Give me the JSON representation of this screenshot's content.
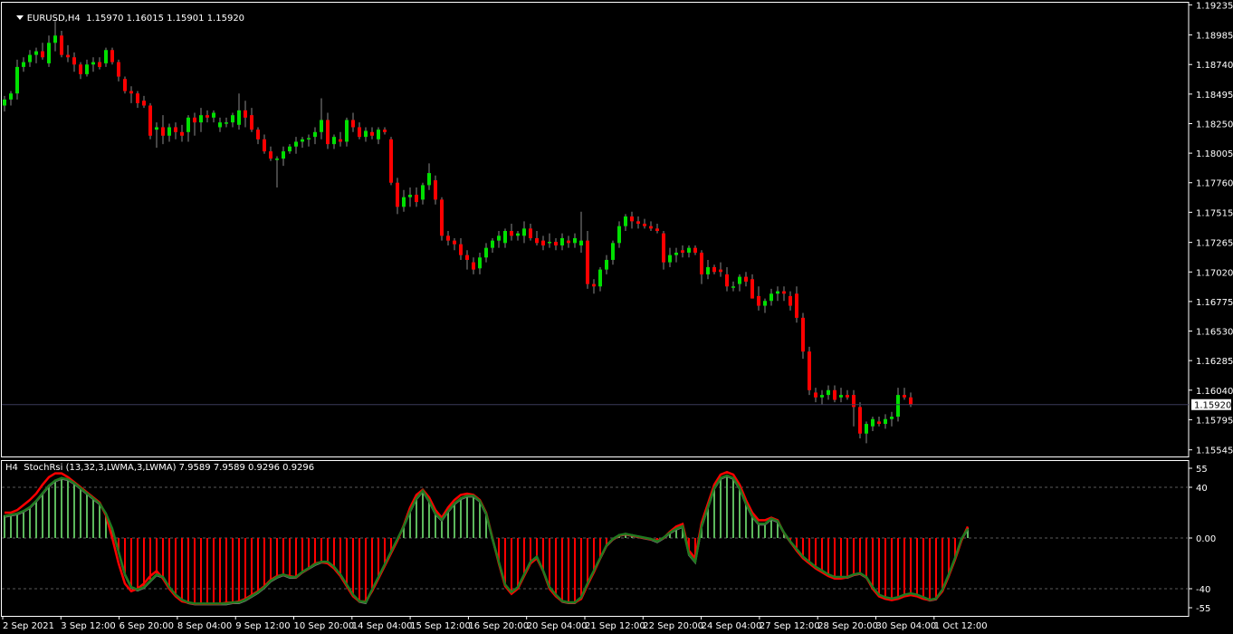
{
  "main_chart": {
    "symbol_period": "EURUSD,H4",
    "ohlc_text": "1.15970 1.16015 1.15901 1.15920",
    "current_price_label": "1.15920",
    "price_min": 1.1549,
    "price_max": 1.1926,
    "bull_color": "#00e000",
    "bear_color": "#ff0000",
    "price_ticks": [
      "1.19235",
      "1.18985",
      "1.18740",
      "1.18495",
      "1.18250",
      "1.18005",
      "1.17760",
      "1.17515",
      "1.17265",
      "1.17020",
      "1.16775",
      "1.16530",
      "1.16285",
      "1.16040",
      "1.15795",
      "1.15545"
    ],
    "candles": [
      [
        1.184,
        1.1848,
        1.1835,
        1.1845
      ],
      [
        1.1845,
        1.1852,
        1.184,
        1.185
      ],
      [
        1.185,
        1.1878,
        1.1845,
        1.1872
      ],
      [
        1.1872,
        1.188,
        1.1868,
        1.1876
      ],
      [
        1.1876,
        1.1886,
        1.1872,
        1.1882
      ],
      [
        1.1882,
        1.1888,
        1.1875,
        1.1885
      ],
      [
        1.1885,
        1.1892,
        1.1878,
        1.188
      ],
      [
        1.1875,
        1.1898,
        1.1872,
        1.1892
      ],
      [
        1.1892,
        1.191,
        1.1885,
        1.1898
      ],
      [
        1.1898,
        1.1902,
        1.188,
        1.1882
      ],
      [
        1.1882,
        1.189,
        1.1876,
        1.188
      ],
      [
        1.188,
        1.1884,
        1.1868,
        1.1874
      ],
      [
        1.1874,
        1.1876,
        1.1862,
        1.1866
      ],
      [
        1.1866,
        1.1878,
        1.1864,
        1.1874
      ],
      [
        1.1874,
        1.188,
        1.1868,
        1.1876
      ],
      [
        1.1876,
        1.188,
        1.187,
        1.1872
      ],
      [
        1.1875,
        1.1888,
        1.1872,
        1.1886
      ],
      [
        1.1886,
        1.1888,
        1.1874,
        1.1876
      ],
      [
        1.1876,
        1.1878,
        1.186,
        1.1864
      ],
      [
        1.1862,
        1.1864,
        1.185,
        1.1852
      ],
      [
        1.1852,
        1.1856,
        1.1842,
        1.185
      ],
      [
        1.185,
        1.1852,
        1.1838,
        1.1842
      ],
      [
        1.1844,
        1.1848,
        1.1838,
        1.184
      ],
      [
        1.184,
        1.1842,
        1.1812,
        1.1815
      ],
      [
        1.182,
        1.1826,
        1.1805,
        1.1822
      ],
      [
        1.1822,
        1.1832,
        1.1808,
        1.1815
      ],
      [
        1.1815,
        1.1825,
        1.181,
        1.1822
      ],
      [
        1.1822,
        1.1826,
        1.1812,
        1.1818
      ],
      [
        1.1818,
        1.1824,
        1.181,
        1.1815
      ],
      [
        1.1818,
        1.1832,
        1.181,
        1.183
      ],
      [
        1.183,
        1.1834,
        1.1815,
        1.1826
      ],
      [
        1.1826,
        1.1838,
        1.1818,
        1.1832
      ],
      [
        1.1832,
        1.1836,
        1.1826,
        1.183
      ],
      [
        1.183,
        1.1836,
        1.1826,
        1.1834
      ],
      [
        1.1822,
        1.183,
        1.1818,
        1.1826
      ],
      [
        1.1826,
        1.183,
        1.1822,
        1.1826
      ],
      [
        1.1826,
        1.1834,
        1.1822,
        1.1832
      ],
      [
        1.1824,
        1.185,
        1.182,
        1.1836
      ],
      [
        1.1836,
        1.1844,
        1.1822,
        1.183
      ],
      [
        1.1832,
        1.1838,
        1.1818,
        1.182
      ],
      [
        1.182,
        1.1822,
        1.1808,
        1.1812
      ],
      [
        1.1812,
        1.1816,
        1.18,
        1.1802
      ],
      [
        1.1802,
        1.1806,
        1.1794,
        1.1796
      ],
      [
        1.1796,
        1.1798,
        1.1772,
        1.1796
      ],
      [
        1.1796,
        1.1806,
        1.179,
        1.1802
      ],
      [
        1.1802,
        1.1808,
        1.18,
        1.1806
      ],
      [
        1.1806,
        1.1814,
        1.18,
        1.181
      ],
      [
        1.181,
        1.1814,
        1.1805,
        1.1812
      ],
      [
        1.1812,
        1.1816,
        1.1806,
        1.1813
      ],
      [
        1.1814,
        1.1822,
        1.1808,
        1.1818
      ],
      [
        1.1818,
        1.1846,
        1.1812,
        1.1828
      ],
      [
        1.1828,
        1.1834,
        1.1804,
        1.1808
      ],
      [
        1.1808,
        1.1816,
        1.1804,
        1.1814
      ],
      [
        1.1812,
        1.1818,
        1.1806,
        1.181
      ],
      [
        1.181,
        1.183,
        1.1806,
        1.1828
      ],
      [
        1.1828,
        1.1834,
        1.1818,
        1.1822
      ],
      [
        1.1822,
        1.1826,
        1.1812,
        1.1814
      ],
      [
        1.1814,
        1.1822,
        1.181,
        1.1819
      ],
      [
        1.1818,
        1.1822,
        1.1812,
        1.1815
      ],
      [
        1.1812,
        1.1822,
        1.1808,
        1.182
      ],
      [
        1.182,
        1.1822,
        1.1816,
        1.1818
      ],
      [
        1.1812,
        1.1814,
        1.1774,
        1.1776
      ],
      [
        1.1776,
        1.178,
        1.175,
        1.1756
      ],
      [
        1.1756,
        1.177,
        1.1752,
        1.1764
      ],
      [
        1.1764,
        1.1772,
        1.1756,
        1.1766
      ],
      [
        1.1766,
        1.1772,
        1.1756,
        1.176
      ],
      [
        1.1762,
        1.1776,
        1.1758,
        1.1774
      ],
      [
        1.1774,
        1.1792,
        1.177,
        1.1784
      ],
      [
        1.1778,
        1.1782,
        1.1758,
        1.1762
      ],
      [
        1.1762,
        1.1764,
        1.1728,
        1.1732
      ],
      [
        1.1732,
        1.1736,
        1.1724,
        1.1728
      ],
      [
        1.1728,
        1.173,
        1.172,
        1.1725
      ],
      [
        1.1725,
        1.173,
        1.1712,
        1.1716
      ],
      [
        1.1716,
        1.172,
        1.1704,
        1.1712
      ],
      [
        1.171,
        1.1714,
        1.17,
        1.1704
      ],
      [
        1.1705,
        1.1718,
        1.17,
        1.1714
      ],
      [
        1.1714,
        1.1726,
        1.171,
        1.1722
      ],
      [
        1.1722,
        1.173,
        1.1718,
        1.1728
      ],
      [
        1.1728,
        1.1736,
        1.1722,
        1.1732
      ],
      [
        1.1726,
        1.1738,
        1.1722,
        1.1736
      ],
      [
        1.1736,
        1.1742,
        1.1728,
        1.1732
      ],
      [
        1.1732,
        1.1736,
        1.1728,
        1.1734
      ],
      [
        1.1732,
        1.1744,
        1.1726,
        1.1738
      ],
      [
        1.1738,
        1.1742,
        1.1728,
        1.173
      ],
      [
        1.173,
        1.1736,
        1.1724,
        1.1726
      ],
      [
        1.1728,
        1.1732,
        1.172,
        1.1724
      ],
      [
        1.1726,
        1.1734,
        1.1722,
        1.1727
      ],
      [
        1.1727,
        1.173,
        1.172,
        1.1724
      ],
      [
        1.1724,
        1.1734,
        1.172,
        1.173
      ],
      [
        1.1728,
        1.1732,
        1.1722,
        1.1726
      ],
      [
        1.1726,
        1.1734,
        1.1722,
        1.173
      ],
      [
        1.1724,
        1.1752,
        1.1718,
        1.1728
      ],
      [
        1.1728,
        1.1736,
        1.1688,
        1.1692
      ],
      [
        1.1692,
        1.1696,
        1.1684,
        1.169
      ],
      [
        1.169,
        1.1706,
        1.1686,
        1.1704
      ],
      [
        1.1704,
        1.1716,
        1.17,
        1.1712
      ],
      [
        1.1712,
        1.1728,
        1.1708,
        1.1726
      ],
      [
        1.1726,
        1.1744,
        1.1722,
        1.174
      ],
      [
        1.174,
        1.175,
        1.1736,
        1.1748
      ],
      [
        1.1748,
        1.1752,
        1.1738,
        1.1744
      ],
      [
        1.1744,
        1.1748,
        1.1738,
        1.1742
      ],
      [
        1.1742,
        1.1746,
        1.1738,
        1.174
      ],
      [
        1.174,
        1.1744,
        1.1736,
        1.1738
      ],
      [
        1.1738,
        1.1742,
        1.1734,
        1.1736
      ],
      [
        1.1734,
        1.1736,
        1.1704,
        1.171
      ],
      [
        1.171,
        1.1722,
        1.1706,
        1.1716
      ],
      [
        1.1716,
        1.1722,
        1.171,
        1.1718
      ],
      [
        1.172,
        1.1724,
        1.1714,
        1.1718
      ],
      [
        1.1718,
        1.1724,
        1.1714,
        1.1722
      ],
      [
        1.1722,
        1.1724,
        1.1716,
        1.1718
      ],
      [
        1.1718,
        1.172,
        1.1692,
        1.17
      ],
      [
        1.17,
        1.1712,
        1.1696,
        1.1706
      ],
      [
        1.1706,
        1.1708,
        1.17,
        1.1702
      ],
      [
        1.1704,
        1.171,
        1.1698,
        1.1702
      ],
      [
        1.17,
        1.1706,
        1.1686,
        1.169
      ],
      [
        1.169,
        1.1694,
        1.1686,
        1.169
      ],
      [
        1.1692,
        1.17,
        1.1686,
        1.1698
      ],
      [
        1.1698,
        1.1702,
        1.169,
        1.1694
      ],
      [
        1.1696,
        1.17,
        1.168,
        1.168
      ],
      [
        1.1682,
        1.169,
        1.167,
        1.1674
      ],
      [
        1.1674,
        1.168,
        1.1668,
        1.1678
      ],
      [
        1.1678,
        1.1688,
        1.1674,
        1.1684
      ],
      [
        1.1684,
        1.169,
        1.1678,
        1.1686
      ],
      [
        1.1686,
        1.169,
        1.1678,
        1.1684
      ],
      [
        1.1682,
        1.1686,
        1.167,
        1.1674
      ],
      [
        1.1684,
        1.169,
        1.166,
        1.1664
      ],
      [
        1.1664,
        1.1668,
        1.163,
        1.1636
      ],
      [
        1.1636,
        1.164,
        1.16,
        1.1604
      ],
      [
        1.1602,
        1.1606,
        1.1594,
        1.1598
      ],
      [
        1.1598,
        1.1604,
        1.1592,
        1.16
      ],
      [
        1.16,
        1.1608,
        1.1596,
        1.1604
      ],
      [
        1.1604,
        1.1608,
        1.1594,
        1.1596
      ],
      [
        1.1598,
        1.1606,
        1.1594,
        1.16
      ],
      [
        1.16,
        1.1604,
        1.1596,
        1.1598
      ],
      [
        1.16,
        1.1604,
        1.1574,
        1.159
      ],
      [
        1.159,
        1.1594,
        1.1564,
        1.1568
      ],
      [
        1.1568,
        1.1578,
        1.156,
        1.1576
      ],
      [
        1.1574,
        1.1582,
        1.157,
        1.158
      ],
      [
        1.1578,
        1.1582,
        1.1574,
        1.1576
      ],
      [
        1.1576,
        1.1584,
        1.1572,
        1.158
      ],
      [
        1.158,
        1.1586,
        1.1574,
        1.1582
      ],
      [
        1.1582,
        1.1606,
        1.1578,
        1.16
      ],
      [
        1.16,
        1.1606,
        1.1596,
        1.1598
      ],
      [
        1.1598,
        1.1602,
        1.159,
        1.1592
      ]
    ]
  },
  "indicator": {
    "title": "H4  StochRsi (13,32,3,LWMA,3,LWMA) 7.9589 7.9589 0.9296 0.9296",
    "ymin": -58,
    "ymax": 56,
    "axis_labels": [
      "55",
      "40",
      "0.00",
      "-40",
      "-55"
    ],
    "axis_values": [
      55,
      40,
      0,
      -40,
      -55
    ],
    "level_lines": [
      40,
      0,
      -40
    ],
    "pos_color": "#5cb85c",
    "neg_color": "#ff0000",
    "fast_line_color": "#1f7a1f",
    "slow_line_color": "#ff0000",
    "gray_line_color": "#7a7a7a",
    "values": [
      18,
      19,
      20,
      22,
      25,
      30,
      36,
      42,
      46,
      48,
      47,
      44,
      40,
      36,
      32,
      28,
      20,
      8,
      -10,
      -28,
      -38,
      -40,
      -38,
      -33,
      -28,
      -30,
      -38,
      -44,
      -48,
      -50,
      -51,
      -51,
      -51,
      -51,
      -51,
      -51,
      -50,
      -50,
      -48,
      -45,
      -42,
      -38,
      -33,
      -30,
      -28,
      -30,
      -30,
      -26,
      -23,
      -20,
      -18,
      -18,
      -22,
      -28,
      -36,
      -44,
      -49,
      -50,
      -40,
      -30,
      -20,
      -10,
      0,
      10,
      22,
      32,
      38,
      30,
      20,
      15,
      22,
      28,
      32,
      34,
      34,
      30,
      20,
      0,
      -18,
      -36,
      -42,
      -38,
      -28,
      -18,
      -14,
      -25,
      -38,
      -44,
      -49,
      -50,
      -50,
      -46,
      -35,
      -25,
      -15,
      -5,
      0,
      3,
      4,
      3,
      2,
      1,
      0,
      -2,
      1,
      5,
      8,
      10,
      -12,
      -18,
      10,
      25,
      40,
      48,
      50,
      48,
      40,
      28,
      18,
      12,
      12,
      16,
      14,
      5,
      -2,
      -8,
      -14,
      -18,
      -22,
      -25,
      -28,
      -30,
      -30,
      -30,
      -28,
      -27,
      -30,
      -38,
      -44,
      -46,
      -47,
      -46,
      -44,
      -43,
      -44,
      -46,
      -48,
      -47,
      -40,
      -28,
      -15,
      0,
      8
    ],
    "line_values": [
      20,
      20,
      22,
      26,
      30,
      35,
      42,
      48,
      51,
      51,
      48,
      44,
      40,
      36,
      32,
      28,
      18,
      0,
      -20,
      -36,
      -42,
      -40,
      -36,
      -30,
      -26,
      -32,
      -40,
      -46,
      -50,
      -51,
      -52,
      -52,
      -52,
      -52,
      -52,
      -51,
      -51,
      -50,
      -48,
      -45,
      -42,
      -38,
      -33,
      -30,
      -29,
      -30,
      -31,
      -27,
      -24,
      -20,
      -19,
      -20,
      -24,
      -30,
      -38,
      -46,
      -50,
      -50,
      -42,
      -32,
      -22,
      -12,
      -2,
      10,
      24,
      34,
      38,
      32,
      22,
      16,
      24,
      30,
      34,
      35,
      34,
      30,
      20,
      0,
      -20,
      -38,
      -44,
      -40,
      -30,
      -20,
      -16,
      -26,
      -40,
      -46,
      -50,
      -51,
      -51,
      -48,
      -37,
      -27,
      -16,
      -6,
      -1,
      2,
      3,
      2,
      1,
      0,
      -1,
      -2,
      0,
      5,
      9,
      11,
      -10,
      -16,
      12,
      27,
      42,
      50,
      52,
      50,
      42,
      30,
      20,
      14,
      14,
      16,
      14,
      4,
      -3,
      -10,
      -16,
      -20,
      -24,
      -27,
      -30,
      -32,
      -32,
      -31,
      -29,
      -28,
      -31,
      -40,
      -46,
      -48,
      -49,
      -48,
      -46,
      -45,
      -46,
      -48,
      -49,
      -48,
      -42,
      -30,
      -17,
      -2,
      9
    ]
  },
  "time_axis": {
    "labels": [
      "2 Sep 2021",
      "3 Sep 12:00",
      "6 Sep 20:00",
      "8 Sep 04:00",
      "9 Sep 12:00",
      "10 Sep 20:00",
      "14 Sep 04:00",
      "15 Sep 12:00",
      "16 Sep 20:00",
      "20 Sep 04:00",
      "21 Sep 12:00",
      "22 Sep 20:00",
      "24 Sep 04:00",
      "27 Sep 12:00",
      "28 Sep 20:00",
      "30 Sep 04:00",
      "1 Oct 12:00"
    ]
  }
}
